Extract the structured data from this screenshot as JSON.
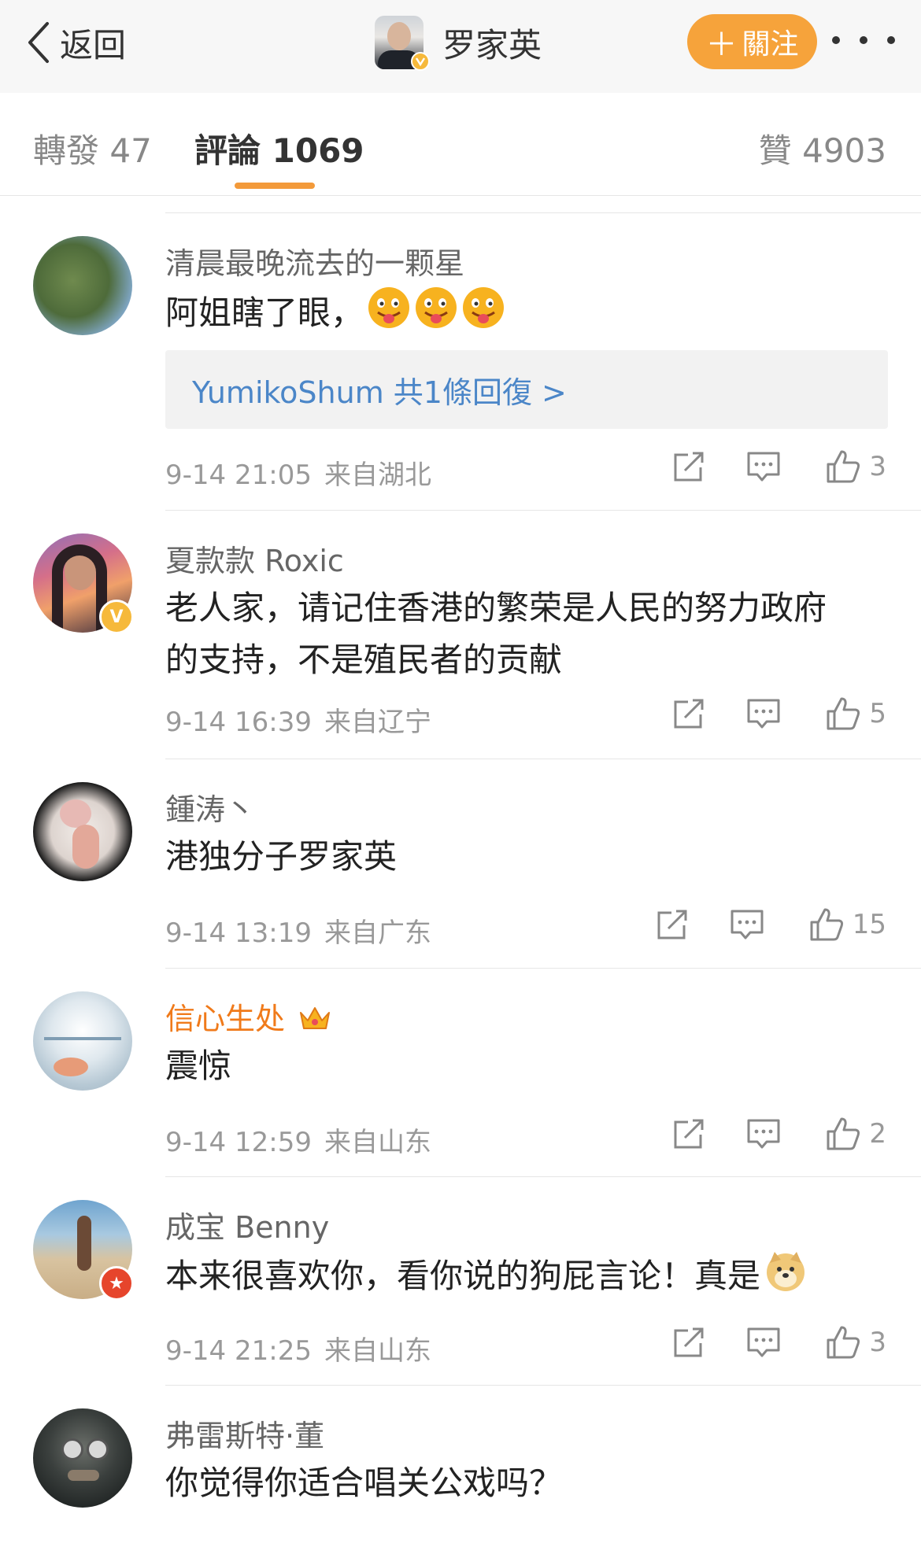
{
  "topbar": {
    "back_label": "返回",
    "title": "罗家英",
    "follow_label": "關注",
    "follow_color": "#f6a33b"
  },
  "tabs": {
    "repost": "轉發 47",
    "comments": "評論 1069",
    "likes": "贊 4903"
  },
  "comments": [
    {
      "name": "清晨最晚流去的一颗星",
      "text": "阿姐瞎了眼，",
      "emoji": "tongue-emoji x3",
      "reply_label": "YumikoShum  共1條回復 >",
      "time": "9-14 21:05",
      "source": "来自湖北",
      "likes": "3"
    },
    {
      "name": "夏款款 Roxic",
      "text_line1": "老人家，请记住香港的繁荣是人民的努力政府",
      "text_line2": "的支持，不是殖民者的贡献",
      "time": "9-14 16:39",
      "source": "来自辽宁",
      "likes": "5"
    },
    {
      "name": "鍾涛丶",
      "text": "港独分子罗家英",
      "time": "9-14 13:19",
      "source": "来自广东",
      "likes": "15"
    },
    {
      "name": "信心生处",
      "name_color": "#f07a1a",
      "text": "震惊",
      "time": "9-14 12:59",
      "source": "来自山东",
      "likes": "2"
    },
    {
      "name": "成宝 Benny",
      "text": "本来很喜欢你，看你说的狗屁言论！真是",
      "time": "9-14 21:25",
      "source": "来自山东",
      "likes": "3"
    },
    {
      "name": "弗雷斯特·董",
      "text": "你觉得你适合唱关公戏吗？"
    }
  ],
  "icons": {
    "back": "chevron-left-icon",
    "more": "more-dots-icon",
    "repost": "repost-icon",
    "comment": "comment-icon",
    "like": "thumbs-up-icon"
  }
}
